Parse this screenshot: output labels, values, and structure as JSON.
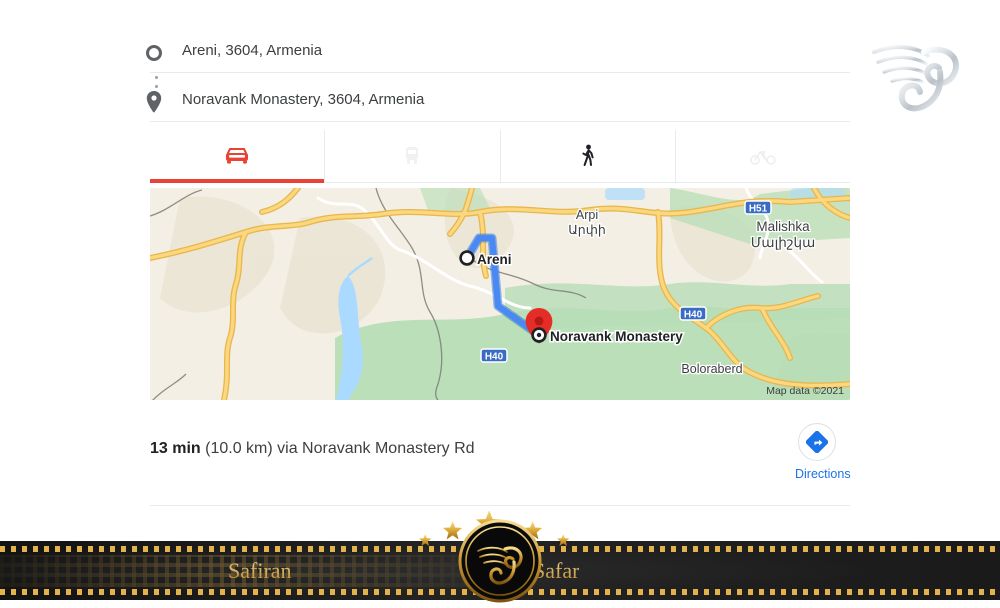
{
  "watermark": {
    "icon": "winged-s-logo"
  },
  "route_form": {
    "origin": {
      "icon": "origin-circle-icon",
      "value": "Areni, 3604, Armenia"
    },
    "destination": {
      "icon": "map-pin-icon",
      "value": "Noravank Monastery, 3604, Armenia"
    }
  },
  "travel_modes": [
    {
      "name": "driving",
      "icon": "car-icon",
      "active": true,
      "enabled": true
    },
    {
      "name": "transit",
      "icon": "transit-icon",
      "active": false,
      "enabled": false
    },
    {
      "name": "walking",
      "icon": "walking-icon",
      "active": false,
      "enabled": true
    },
    {
      "name": "bicycling",
      "icon": "bicycle-icon",
      "active": false,
      "enabled": false
    }
  ],
  "colors": {
    "active_tab": "#ea4335",
    "route_line": "#4a89f3",
    "destination_pin": "#e52d27",
    "link": "#1a73e8",
    "map_land": "#f3efe4",
    "map_green": "#b7ddb6",
    "map_water": "#aadaff",
    "map_road": "#f9d67a",
    "shield_blue": "#3b6cc4",
    "gold": "#e3b24a"
  },
  "map": {
    "labels": [
      {
        "name": "areni-marker-label",
        "text": "Areni"
      },
      {
        "name": "noravank-marker-label",
        "text": "Noravank Monastery"
      },
      {
        "name": "arpi-label",
        "text": "Arpi"
      },
      {
        "name": "arpi-label-armenian",
        "text": "Արփի"
      },
      {
        "name": "malishka-label",
        "text": "Malishka"
      },
      {
        "name": "malishka-label-armenian",
        "text": "Մալիշկա"
      },
      {
        "name": "boloraberd-label",
        "text": "Boloraberd"
      }
    ],
    "road_shields": [
      {
        "name": "shield-h51",
        "text": "H51"
      },
      {
        "name": "shield-h40-east",
        "text": "H40"
      },
      {
        "name": "shield-h40-west",
        "text": "H40"
      }
    ],
    "attribution": "Map data ©2021"
  },
  "route_summary": {
    "duration": "13 min",
    "distance_and_road": " (10.0 km) via Noravank Monastery Rd"
  },
  "directions_button": {
    "icon": "directions-arrow-icon",
    "label": "Directions"
  },
  "footer": {
    "brand_left": "Safiran",
    "brand_right": "Safar",
    "medallion_icon": "winged-s-medallion-icon",
    "stars_icon": "five-gold-stars-icon"
  }
}
